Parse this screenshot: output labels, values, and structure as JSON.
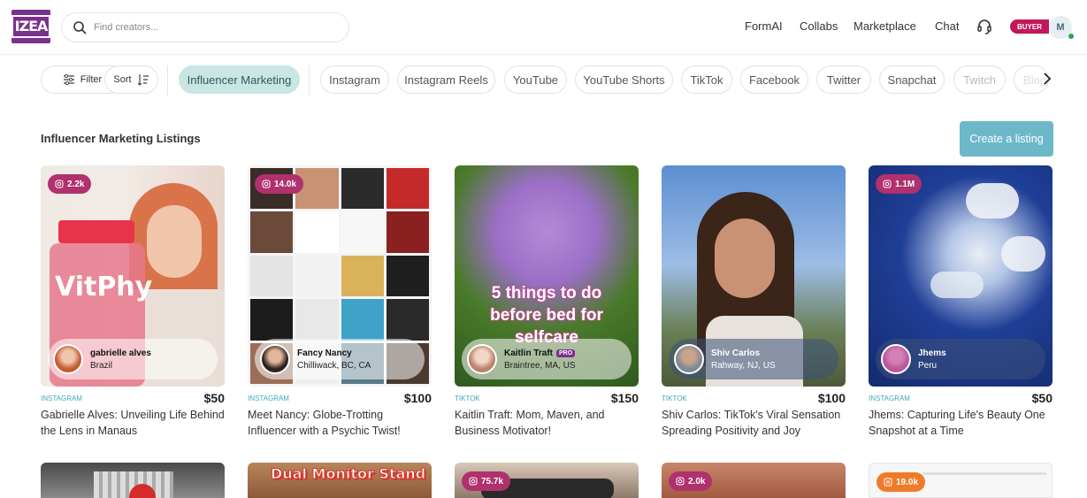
{
  "header": {
    "logo_text": "IZEA",
    "search_placeholder": "Find creators...",
    "nav": [
      "FormAI",
      "Collabs",
      "Marketplace",
      "Chat"
    ],
    "buyer_badge": "BUYER",
    "avatar_initial": "M"
  },
  "filters": {
    "filter_label": "Filter",
    "sort_label": "Sort",
    "chips": [
      "Influencer Marketing",
      "Instagram",
      "Instagram Reels",
      "YouTube",
      "YouTube Shorts",
      "TikTok",
      "Facebook",
      "Twitter",
      "Snapchat",
      "Twitch",
      "Blog"
    ]
  },
  "section": {
    "title": "Influencer Marketing Listings",
    "create_button": "Create a listing"
  },
  "cards": [
    {
      "stat": "2.2k",
      "creator_name": "gabrielle alves",
      "creator_location": "Brazil",
      "platform": "INSTAGRAM",
      "price": "$50",
      "title": "Gabrielle Alves: Unveiling Life Behind the Lens in Manaus"
    },
    {
      "stat": "14.0k",
      "creator_name": "Fancy Nancy",
      "creator_location": "Chilliwack, BC, CA",
      "platform": "INSTAGRAM",
      "price": "$100",
      "title": "Meet Nancy: Globe-Trotting Influencer with a Psychic Twist!"
    },
    {
      "stat": "",
      "creator_name": "Kaitlin Traft",
      "creator_badge": "PRO",
      "creator_location": "Braintree, MA, US",
      "platform": "TIKTOK",
      "price": "$150",
      "title": "Kaitlin Traft: Mom, Maven, and Business Motivator!",
      "image_text": "5 things to do before bed for selfcare"
    },
    {
      "stat": "",
      "creator_name": "Shiv Carlos",
      "creator_location": "Rahway, NJ, US",
      "platform": "TIKTOK",
      "price": "$100",
      "title": "Shiv Carlos: TikTok's Viral Sensation Spreading Positivity and Joy"
    },
    {
      "stat": "1.1M",
      "creator_name": "Jhems",
      "creator_location": "Peru",
      "platform": "INSTAGRAM",
      "price": "$50",
      "title": "Jhems: Capturing Life's Beauty One Snapshot at a Time"
    }
  ],
  "next_row": [
    {
      "stat": ""
    },
    {
      "image_text": "Dual Monitor Stand"
    },
    {
      "stat": "75.7k"
    },
    {
      "stat": "2.0k"
    },
    {
      "stat": "19.0k"
    }
  ],
  "colors": {
    "accent": "#6cb8c8",
    "stat_badge": "#b0316d",
    "active_chip": "#c9e6e3",
    "platform": "#3fa8b5",
    "brand": "#7b2f8f"
  }
}
